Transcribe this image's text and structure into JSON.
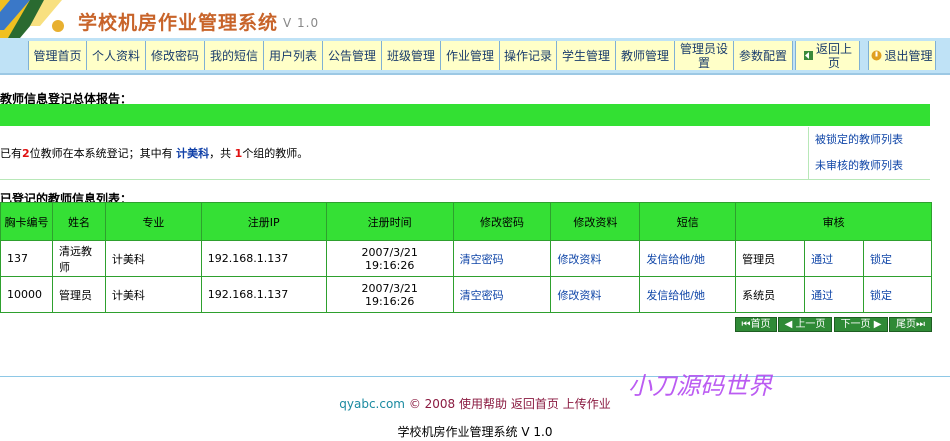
{
  "app": {
    "title": "学校机房作业管理系统",
    "version": "V 1.0"
  },
  "nav": {
    "items": [
      {
        "label": "管理首页"
      },
      {
        "label": "个人资料"
      },
      {
        "label": "修改密码"
      },
      {
        "label": "我的短信"
      },
      {
        "label": "用户列表"
      },
      {
        "label": "公告管理"
      },
      {
        "label": "班级管理"
      },
      {
        "label": "作业管理"
      },
      {
        "label": "操作记录"
      },
      {
        "label": "学生管理"
      },
      {
        "label": "教师管理"
      },
      {
        "label": "管理员设置"
      },
      {
        "label": "参数配置"
      },
      {
        "label": "返回上页",
        "icon": "back-arrow-icon"
      },
      {
        "label": "退出管理",
        "icon": "exit-icon"
      }
    ]
  },
  "report": {
    "title": "教师信息登记总体报告：",
    "summary": {
      "prefix": "已有",
      "teacher_count": "2",
      "mid1": "位教师在本系统登记；其中有",
      "group_name": "计美科",
      "mid2": "，共",
      "group_count": "1",
      "suffix": "个组的教师。"
    },
    "links": {
      "locked": "被锁定的教师列表",
      "unreviewed": "未审核的教师列表"
    }
  },
  "teacher_list": {
    "title": "已登记的教师信息列表：",
    "columns": [
      "胸卡编号",
      "姓名",
      "专业",
      "注册IP",
      "注册时间",
      "修改密码",
      "修改资料",
      "短信",
      "审核"
    ],
    "rows": [
      {
        "id": "137",
        "name": "清远教师",
        "major": "计美科",
        "ip": "192.168.1.137",
        "date": "2007/3/21",
        "time": "19:16:26",
        "pwd": "清空密码",
        "edit": "修改资料",
        "msg": "发信给他/她",
        "role": "管理员",
        "approve": "通过",
        "lock": "锁定"
      },
      {
        "id": "10000",
        "name": "管理员",
        "major": "计美科",
        "ip": "192.168.1.137",
        "date": "2007/3/21",
        "time": "19:16:26",
        "pwd": "清空密码",
        "edit": "修改资料",
        "msg": "发信给他/她",
        "role": "系统员",
        "approve": "通过",
        "lock": "锁定"
      }
    ]
  },
  "pager": {
    "first": "首页",
    "prev": "上一页",
    "next": "下一页",
    "last": "尾页"
  },
  "footer": {
    "site": "qyabc.com",
    "copyright": "© 2008",
    "help": "使用帮助",
    "home": "返回首页",
    "upload": "上传作业",
    "line2": "学校机房作业管理系统 V 1.0"
  },
  "watermark": "小刀源码世界",
  "colors": {
    "nav_bg": "#bfe2f6",
    "nav_item_bg": "#ffffc8",
    "green_header": "#35e035",
    "title_orange": "#c8642a",
    "link_blue": "#1046a8",
    "count_red": "#e01010"
  }
}
